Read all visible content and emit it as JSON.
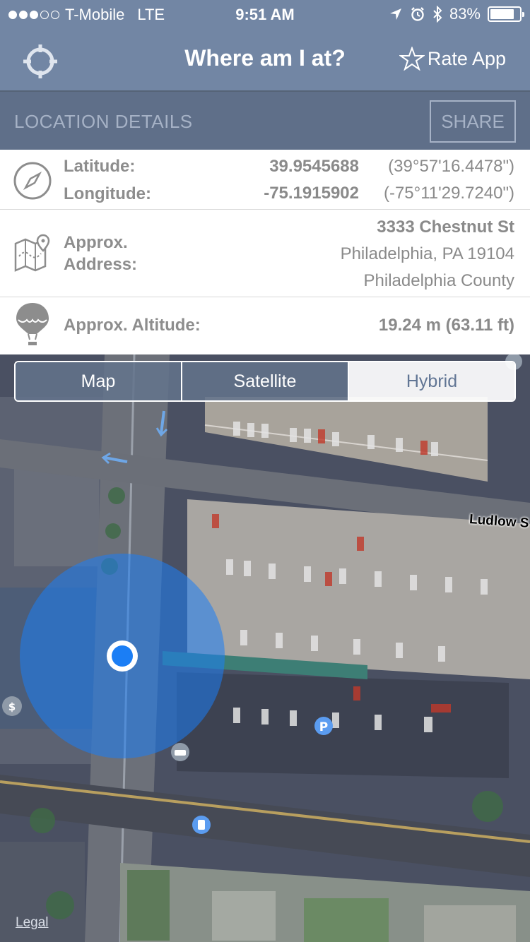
{
  "status_bar": {
    "carrier": "T-Mobile",
    "network": "LTE",
    "time": "9:51 AM",
    "battery": "83%",
    "battery_level": 0.83
  },
  "nav": {
    "title": "Where am I at?",
    "rate_label": "Rate App"
  },
  "details": {
    "title": "LOCATION DETAILS",
    "share_label": "SHARE"
  },
  "coords": {
    "lat_label": "Latitude:",
    "lat_value": "39.9545688",
    "lat_dms": "(39°57'16.4478\")",
    "lon_label": "Longitude:",
    "lon_value": "-75.1915902",
    "lon_dms": "(-75°11'29.7240\")"
  },
  "address": {
    "label_line1": "Approx.",
    "label_line2": "Address:",
    "street": "3333 Chestnut St",
    "city": "Philadelphia, PA 19104",
    "county": "Philadelphia County"
  },
  "altitude": {
    "label": "Approx. Altitude:",
    "value": "19.24 m (63.11 ft)"
  },
  "map": {
    "modes": [
      "Map",
      "Satellite",
      "Hybrid"
    ],
    "selected_mode": "Hybrid",
    "street_label": "Ludlow S",
    "legal": "Legal",
    "accent": "#1b7ef5"
  }
}
